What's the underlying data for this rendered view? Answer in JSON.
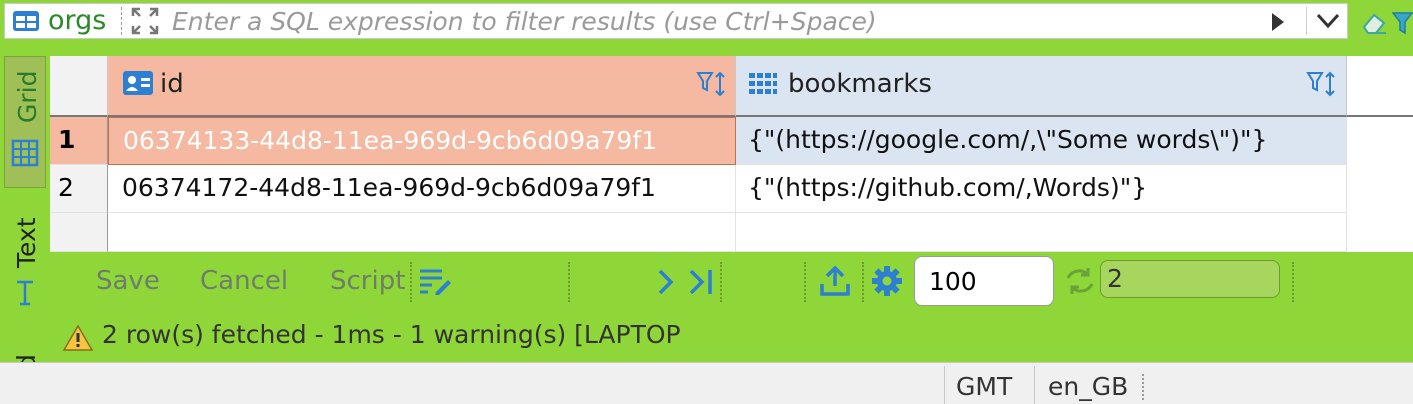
{
  "filter": {
    "table_name": "orgs",
    "placeholder": "Enter a SQL expression to filter results (use Ctrl+Space)"
  },
  "tabs": {
    "grid": "Grid",
    "text": "Text",
    "cut": "d"
  },
  "columns": [
    {
      "name": "id",
      "icon": "key-column-icon"
    },
    {
      "name": "bookmarks",
      "icon": "array-column-icon"
    }
  ],
  "rows": [
    {
      "num": "1",
      "id": "06374133-44d8-11ea-969d-9cb6d09a79f1",
      "bookmarks": "{\"(https://google.com/,\\\"Some words\\\")\"}"
    },
    {
      "num": "2",
      "id": "06374172-44d8-11ea-969d-9cb6d09a79f1",
      "bookmarks": "{\"(https://github.com/,Words)\"}"
    }
  ],
  "toolbar": {
    "save": "Save",
    "cancel": "Cancel",
    "script": "Script",
    "fetch_size": "100",
    "row_count": "2"
  },
  "status": {
    "message": "2 row(s) fetched - 1ms - 1 warning(s) [LAPTOP"
  },
  "bottom": {
    "timezone": "GMT",
    "locale": "en_GB"
  },
  "colors": {
    "accent_green": "#8fd739",
    "selected_row": "#f4b9a0",
    "header_id": "#f4b9a0",
    "header_other": "#dbe5f1",
    "icon_blue": "#2c7fd1"
  }
}
